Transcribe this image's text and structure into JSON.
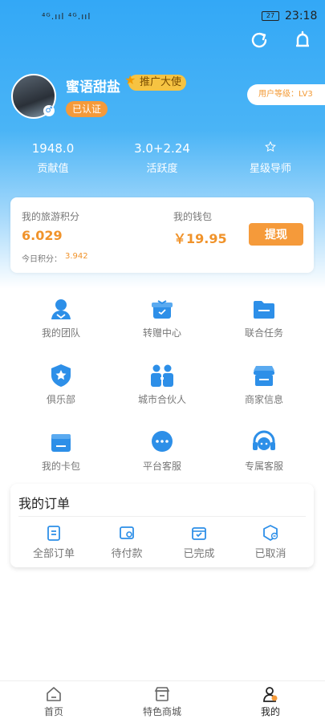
{
  "status_bar": {
    "signal": "⁴ᴳ.ııl ⁴ᴳ.ııl",
    "battery": "27",
    "time": "23:18"
  },
  "profile": {
    "nickname": "蜜语甜盐",
    "badge": "推广大使",
    "verified": "已认证",
    "user_level": "用户等级：LV3"
  },
  "stats": [
    {
      "value": "1948.0",
      "label": "贡献值"
    },
    {
      "value": "3.0+2.24",
      "label": "活跃度"
    },
    {
      "value": "",
      "label": "星级导师"
    }
  ],
  "wallet_card": {
    "points_label": "我的旅游积分",
    "points_value": "6.029",
    "today_label": "今日积分：",
    "today_value": "3.942",
    "wallet_label": "我的钱包",
    "wallet_value": "￥19.95",
    "withdraw": "提现"
  },
  "menu": [
    {
      "label": "我的团队",
      "icon": "team-icon"
    },
    {
      "label": "转赠中心",
      "icon": "gift-icon"
    },
    {
      "label": "联合任务",
      "icon": "folder-icon"
    },
    {
      "label": "俱乐部",
      "icon": "shield-star-icon"
    },
    {
      "label": "城市合伙人",
      "icon": "partners-icon"
    },
    {
      "label": "商家信息",
      "icon": "store-icon"
    },
    {
      "label": "我的卡包",
      "icon": "card-wallet-icon"
    },
    {
      "label": "平台客服",
      "icon": "chat-icon"
    },
    {
      "label": "专属客服",
      "icon": "headset-icon"
    }
  ],
  "orders": {
    "title": "我的订单",
    "items": [
      {
        "label": "全部订单",
        "icon": "clipboard-icon"
      },
      {
        "label": "待付款",
        "icon": "wallet-icon"
      },
      {
        "label": "已完成",
        "icon": "box-check-icon"
      },
      {
        "label": "已取消",
        "icon": "box-cancel-icon"
      }
    ]
  },
  "tabbar": [
    {
      "label": "首页",
      "icon": "home-icon"
    },
    {
      "label": "特色商城",
      "icon": "shop-icon"
    },
    {
      "label": "我的",
      "icon": "user-icon"
    }
  ],
  "colors": {
    "primary": "#33a8f6",
    "accent": "#f59a3a",
    "badge": "#f6c342"
  }
}
